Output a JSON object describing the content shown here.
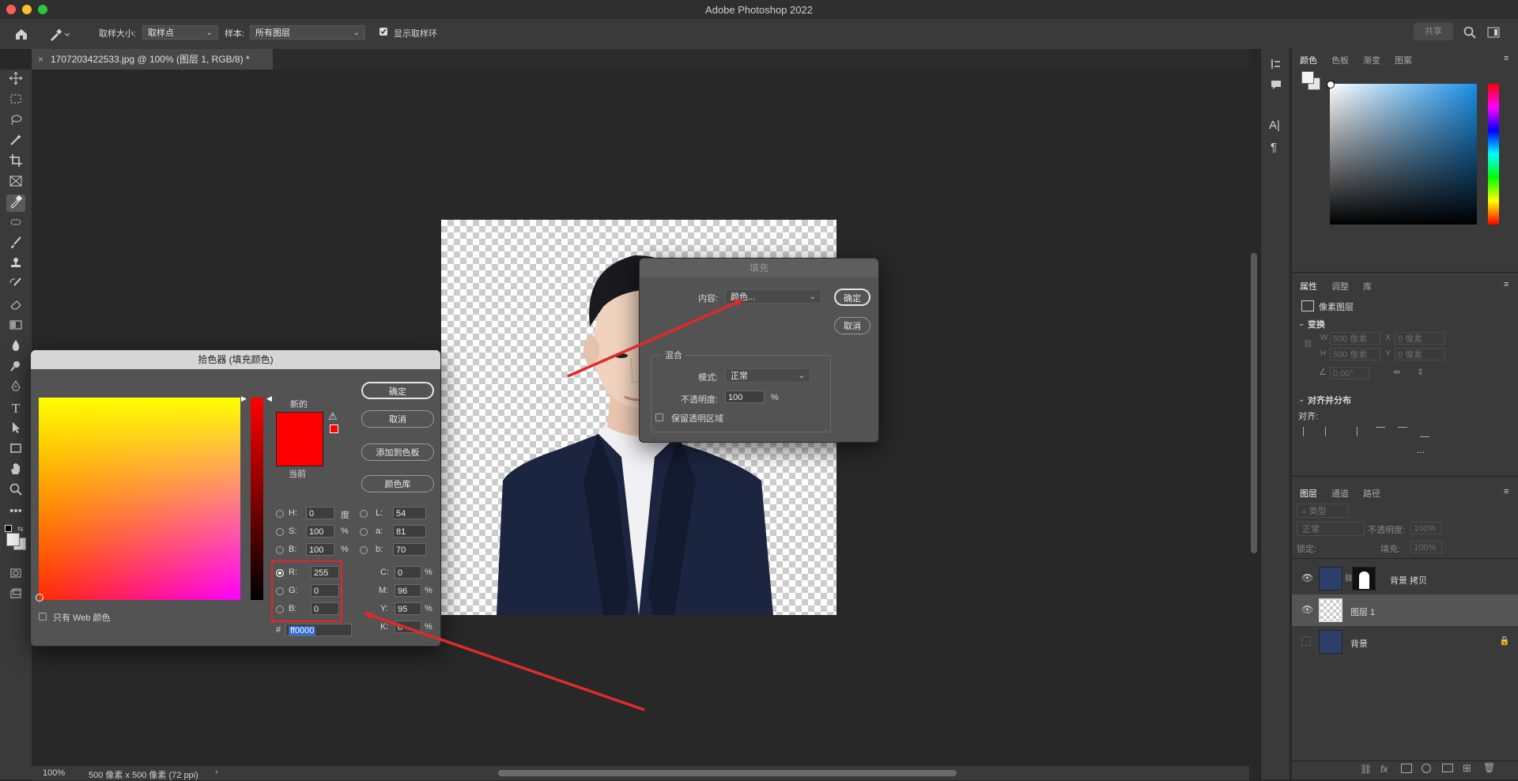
{
  "app": {
    "window_title": "Adobe Photoshop 2022"
  },
  "options_bar": {
    "sample_size_label": "取样大小:",
    "sample_size_value": "取样点",
    "sample_label": "样本:",
    "sample_value": "所有图层",
    "show_ring_label": "显示取样环",
    "share_label": "共享"
  },
  "document": {
    "tab_title": "1707203422533.jpg @ 100% (图层 1, RGB/8) *",
    "zoom": "100%",
    "size_info": "500 像素 x 500 像素 (72 ppi)"
  },
  "color_panel": {
    "tabs": [
      "颜色",
      "色板",
      "渐变",
      "图案"
    ],
    "active_tab": "颜色"
  },
  "properties_panel": {
    "tabs": [
      "属性",
      "调整",
      "库"
    ],
    "pixel_layer_label": "像素图层",
    "transform_label": "变换",
    "w_label": "W",
    "w_value": "500 像素",
    "x_label": "X",
    "x_value": "0 像素",
    "h_label": "H",
    "h_value": "500 像素",
    "y_label": "Y",
    "y_value": "0 像素",
    "angle_value": "0.00°",
    "align_section": "对齐并分布",
    "align_label": "对齐:",
    "more": "..."
  },
  "layers_panel": {
    "tabs": [
      "图层",
      "通道",
      "路径"
    ],
    "filter_label": "类型",
    "blend_mode": "正常",
    "opacity_label": "不透明度:",
    "opacity_value": "100%",
    "lock_label": "锁定:",
    "fill_label": "填充:",
    "fill_value": "100%",
    "layers": [
      {
        "name": "背景 拷贝"
      },
      {
        "name": "图层 1"
      },
      {
        "name": "背景"
      }
    ]
  },
  "color_picker": {
    "title": "拾色器 (填充颜色)",
    "new_label": "新的",
    "current_label": "当前",
    "ok_label": "确定",
    "cancel_label": "取消",
    "add_swatch_label": "添加到色板",
    "color_lib_label": "颜色库",
    "web_only_label": "只有 Web 颜色",
    "H_label": "H:",
    "H": "0",
    "H_unit": "度",
    "S_label": "S:",
    "S": "100",
    "S_unit": "%",
    "Bv_label": "B:",
    "Bv": "100",
    "Bv_unit": "%",
    "R_label": "R:",
    "R": "255",
    "G_label": "G:",
    "G": "0",
    "Bc_label": "B:",
    "Bc": "0",
    "L_label": "L:",
    "L": "54",
    "a_label": "a:",
    "a": "81",
    "b_label": "b:",
    "b": "70",
    "C_label": "C:",
    "C": "0",
    "C_unit": "%",
    "M_label": "M:",
    "M": "96",
    "M_unit": "%",
    "Y_label": "Y:",
    "Y": "95",
    "Y_unit": "%",
    "K_label": "K:",
    "K": "0",
    "K_unit": "%",
    "hash": "#",
    "hex": "ff0000",
    "new_color": "#ff0000",
    "current_color": "#ff0000"
  },
  "fill_dialog": {
    "title": "填充",
    "content_label": "内容:",
    "content_value": "颜色...",
    "ok_label": "确定",
    "cancel_label": "取消",
    "blend_section": "混合",
    "mode_label": "模式:",
    "mode_value": "正常",
    "opacity_label": "不透明度:",
    "opacity_value": "100",
    "opacity_unit": "%",
    "preserve_label": "保留透明区域"
  },
  "colors": {
    "highlight_red": "#e8232a",
    "annotation_red": "#e02a2a"
  }
}
